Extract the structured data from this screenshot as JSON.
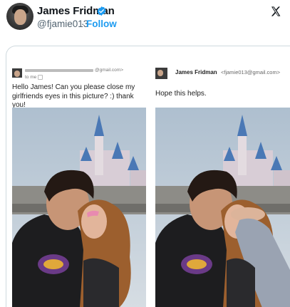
{
  "tweet": {
    "author_name": "James Fridman",
    "author_handle": "@fjamie013",
    "separator": "·",
    "follow_label": "Follow",
    "verified_color": "#1d9bf0"
  },
  "left_email": {
    "sender_suffix": "@gmail.com>",
    "to_me": "to me",
    "message": "Hello James! Can you please close my girlfriends eyes in this picture? :) thank you!"
  },
  "right_email": {
    "sender_name": "James Fridman",
    "sender_email": "<fjamie013@gmail.com>",
    "message": "Hope this helps."
  },
  "icons": [
    "verified-badge-icon",
    "x-logo-icon",
    "caret-down-icon"
  ]
}
